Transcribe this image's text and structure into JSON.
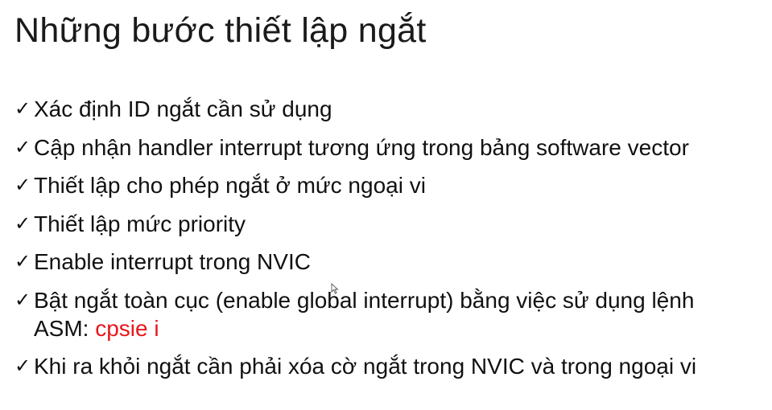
{
  "slide": {
    "title": "Những bước thiết lập ngắt",
    "bullet_icon": "check-mark",
    "items": [
      {
        "text": "Xác định ID ngắt cần sử dụng"
      },
      {
        "text": "Cập nhận handler interrupt tương ứng trong bảng software vector"
      },
      {
        "text": "Thiết lập cho phép ngắt ở mức ngoại vi"
      },
      {
        "text": "Thiết lập mức priority"
      },
      {
        "text": "Enable interrupt trong NVIC"
      },
      {
        "text": "Bật ngắt toàn cục (enable global interrupt) bằng việc sử dụng lệnh",
        "text_line2": "ASM: ",
        "command": "cpsie i"
      },
      {
        "text": "Khi ra khỏi ngắt cần phải xóa cờ ngắt trong NVIC và trong ngoại vi"
      }
    ],
    "colors": {
      "command": "#e8161b",
      "text": "#111111"
    }
  }
}
